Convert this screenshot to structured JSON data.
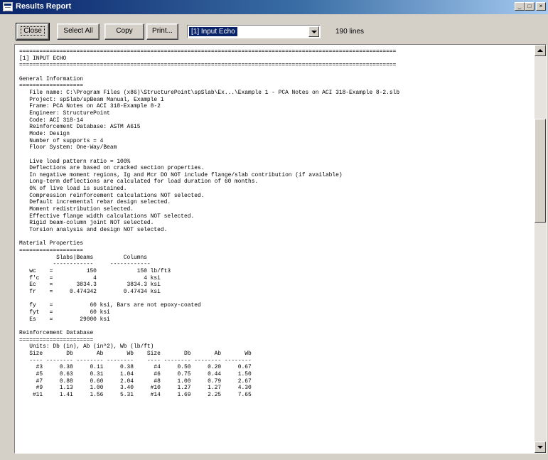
{
  "window": {
    "title": "Results Report",
    "minimize": "_",
    "maximize": "□",
    "close": "×"
  },
  "toolbar": {
    "close_label": "Close",
    "select_all_label": "Select All",
    "copy_label": "Copy",
    "print_label": "Print...",
    "section_select": "[1] Input Echo",
    "line_count": "190 lines"
  },
  "report": {
    "lines": [
      "================================================================================================================",
      "[1] INPUT ECHO",
      "================================================================================================================",
      "",
      "General Information",
      "===================",
      "   File name: C:\\Program Files (x86)\\StructurePoint\\spSlab\\Ex...\\Example 1 - PCA Notes on ACI 318-Example 8-2.slb",
      "   Project: spSlab/spBeam Manual, Example 1",
      "   Frame: PCA Notes on ACI 318-Example 8-2",
      "   Engineer: StructurePoint",
      "   Code: ACI 318-14",
      "   Reinforcement Database: ASTM A615",
      "   Mode: Design",
      "   Number of supports = 4",
      "   Floor System: One-Way/Beam",
      "",
      "   Live load pattern ratio = 100%",
      "   Deflections are based on cracked section properties.",
      "   In negative moment regions, Ig and Mcr DO NOT include flange/slab contribution (if available)",
      "   Long-term deflections are calculated for load duration of 60 months.",
      "   0% of live load is sustained.",
      "   Compression reinforcement calculations NOT selected.",
      "   Default incremental rebar design selected.",
      "   Moment redistribution selected.",
      "   Effective flange width calculations NOT selected.",
      "   Rigid beam-column joint NOT selected.",
      "   Torsion analysis and design NOT selected.",
      "",
      "Material Properties",
      "===================",
      "           Slabs|Beams         Columns",
      "          ------------     ------------",
      "   wc    =          150            150 lb/ft3",
      "   f'c   =            4              4 ksi",
      "   Ec    =       3834.3         3834.3 ksi",
      "   fr    =     0.474342        0.47434 ksi",
      "",
      "   fy    =           60 ksi, Bars are not epoxy-coated",
      "   fyt   =           60 ksi",
      "   Es    =        29000 ksi",
      "",
      "Reinforcement Database",
      "======================",
      "   Units: Db (in), Ab (in^2), Wb (lb/ft)",
      "   Size       Db       Ab       Wb    Size       Db       Ab       Wb",
      "   ---- -------- -------- --------    ---- -------- -------- --------",
      "     #3     0.38     0.11     0.38      #4     0.50     0.20     0.67",
      "     #5     0.63     0.31     1.04      #6     0.75     0.44     1.50",
      "     #7     0.88     0.60     2.04      #8     1.00     0.79     2.67",
      "     #9     1.13     1.00     3.40     #10     1.27     1.27     4.30",
      "    #11     1.41     1.56     5.31     #14     1.69     2.25     7.65"
    ]
  }
}
